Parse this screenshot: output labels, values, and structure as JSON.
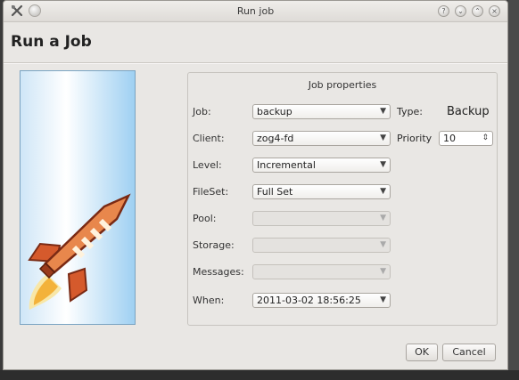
{
  "window": {
    "title": "Run job",
    "controls": [
      "help",
      "minimize",
      "maximize",
      "close"
    ]
  },
  "page_heading": "Run a Job",
  "group_title": "Job properties",
  "fields": {
    "job": {
      "label": "Job:",
      "value": "backup"
    },
    "client": {
      "label": "Client:",
      "value": "zog4-fd"
    },
    "level": {
      "label": "Level:",
      "value": "Incremental"
    },
    "fileset": {
      "label": "FileSet:",
      "value": "Full Set"
    },
    "pool": {
      "label": "Pool:",
      "value": ""
    },
    "storage": {
      "label": "Storage:",
      "value": ""
    },
    "messages": {
      "label": "Messages:",
      "value": ""
    },
    "when": {
      "label": "When:",
      "value": "2011-03-02 18:56:25"
    }
  },
  "type": {
    "label": "Type:",
    "value": "Backup"
  },
  "priority": {
    "label": "Priority",
    "value": "10"
  },
  "buttons": {
    "ok": "OK",
    "cancel": "Cancel"
  },
  "icons": {
    "app": "tools-icon",
    "rocket": "rocket-icon"
  }
}
